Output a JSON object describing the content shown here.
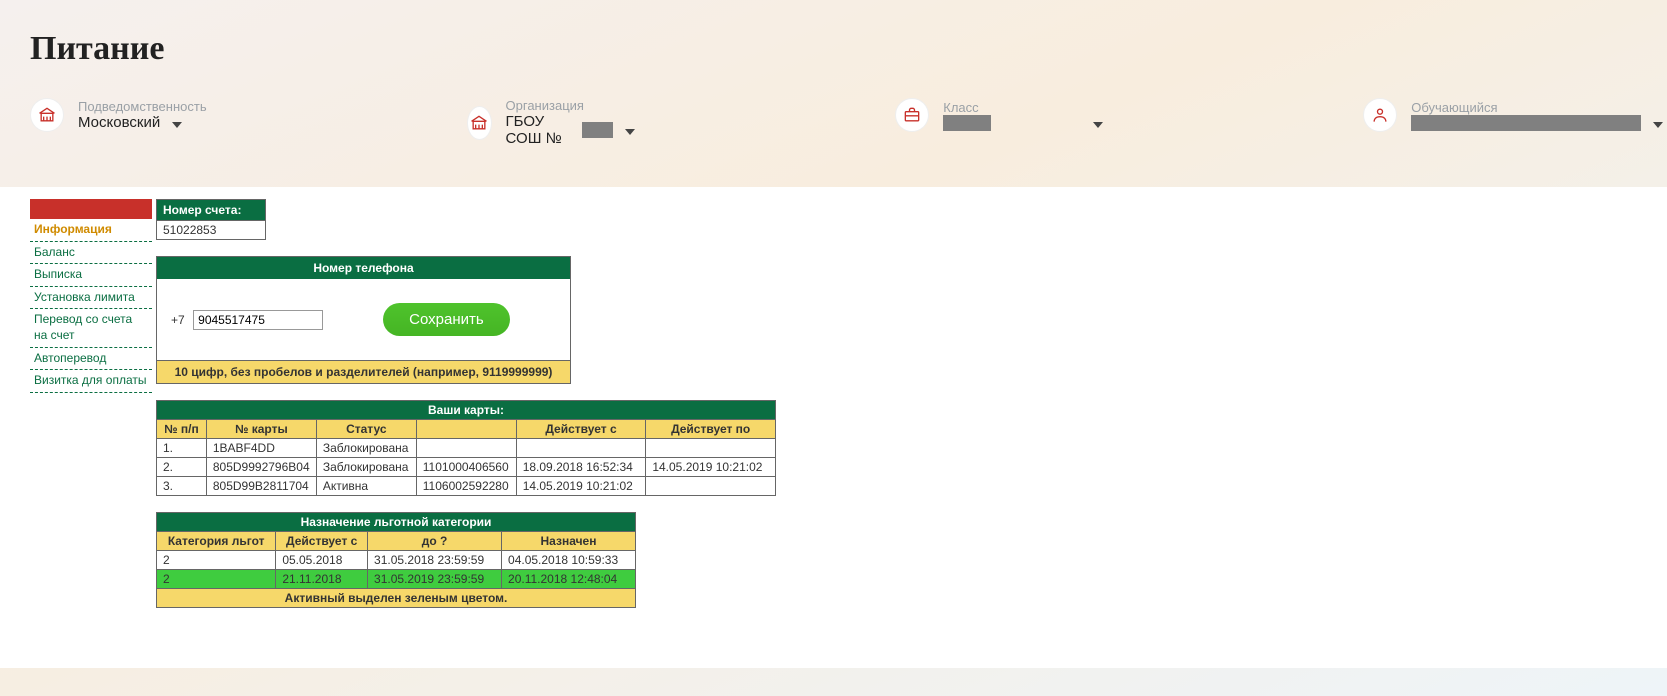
{
  "page_title": "Питание",
  "filters": {
    "dept": {
      "label": "Подведомственность",
      "value": "Московский"
    },
    "org": {
      "label": "Организация",
      "value": "ГБОУ СОШ №"
    },
    "class": {
      "label": "Класс",
      "value": ""
    },
    "student": {
      "label": "Обучающийся",
      "value": ""
    }
  },
  "sidebar": {
    "items": [
      "Информация",
      "Баланс",
      "Выписка",
      "Установка лимита",
      "Перевод со счета на счет",
      "Автоперевод",
      "Визитка для оплаты"
    ]
  },
  "account": {
    "label": "Номер счета:",
    "value": "51022853"
  },
  "phone": {
    "header": "Номер телефона",
    "prefix": "+7",
    "value": "9045517475",
    "save": "Сохранить",
    "hint": "10 цифр, без пробелов и разделителей (например, 9119999999)"
  },
  "cards": {
    "title": "Ваши карты:",
    "cols": [
      "№ п/п",
      "№ карты",
      "Статус",
      "",
      "Действует с",
      "Действует по"
    ],
    "rows": [
      [
        "1.",
        "1BABF4DD",
        "Заблокирована",
        "",
        "",
        ""
      ],
      [
        "2.",
        "805D9992796B04",
        "Заблокирована",
        "1101000406560",
        "18.09.2018 16:52:34",
        "14.05.2019 10:21:02"
      ],
      [
        "3.",
        "805D99B2811704",
        "Активна",
        "1106002592280",
        "14.05.2019 10:21:02",
        ""
      ]
    ]
  },
  "benefit": {
    "title": "Назначение льготной категории",
    "cols": [
      "Категория льгот",
      "Действует с",
      "до ?",
      "Назначен"
    ],
    "rows": [
      {
        "cells": [
          "2",
          "05.05.2018",
          "31.05.2018 23:59:59",
          "04.05.2018 10:59:33"
        ],
        "active": false
      },
      {
        "cells": [
          "2",
          "21.11.2018",
          "31.05.2019 23:59:59",
          "20.11.2018 12:48:04"
        ],
        "active": true
      }
    ],
    "footer": "Активный выделен зеленым цветом."
  }
}
